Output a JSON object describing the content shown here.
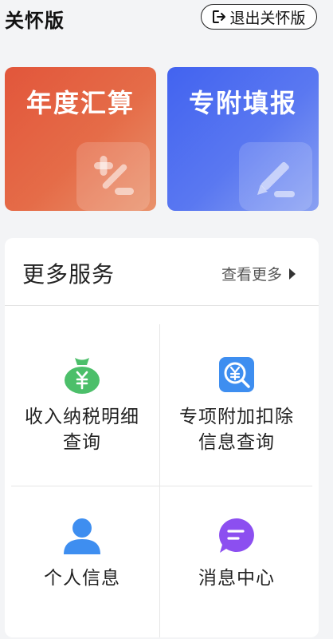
{
  "header": {
    "mode_title": "关怀版",
    "exit_label": "退出关怀版"
  },
  "cards": [
    {
      "title": "年度汇算",
      "icon": "plus-minus-icon",
      "gradient": [
        "#e2563b",
        "#e9926c"
      ]
    },
    {
      "title": "专附填报",
      "icon": "pencil-icon",
      "gradient": [
        "#4263f0",
        "#8aa1f2"
      ]
    }
  ],
  "services": {
    "title": "更多服务",
    "more_label": "查看更多",
    "items": [
      {
        "label": "收入纳税明细\n查询",
        "icon": "money-bag-icon",
        "color": "#4cbf6a"
      },
      {
        "label": "专项附加扣除\n信息查询",
        "icon": "yuan-search-icon",
        "color": "#3e8ef0"
      },
      {
        "label": "个人信息",
        "icon": "person-icon",
        "color": "#3e8ef0"
      },
      {
        "label": "消息中心",
        "icon": "message-icon",
        "color": "#8c4ff0"
      }
    ]
  }
}
